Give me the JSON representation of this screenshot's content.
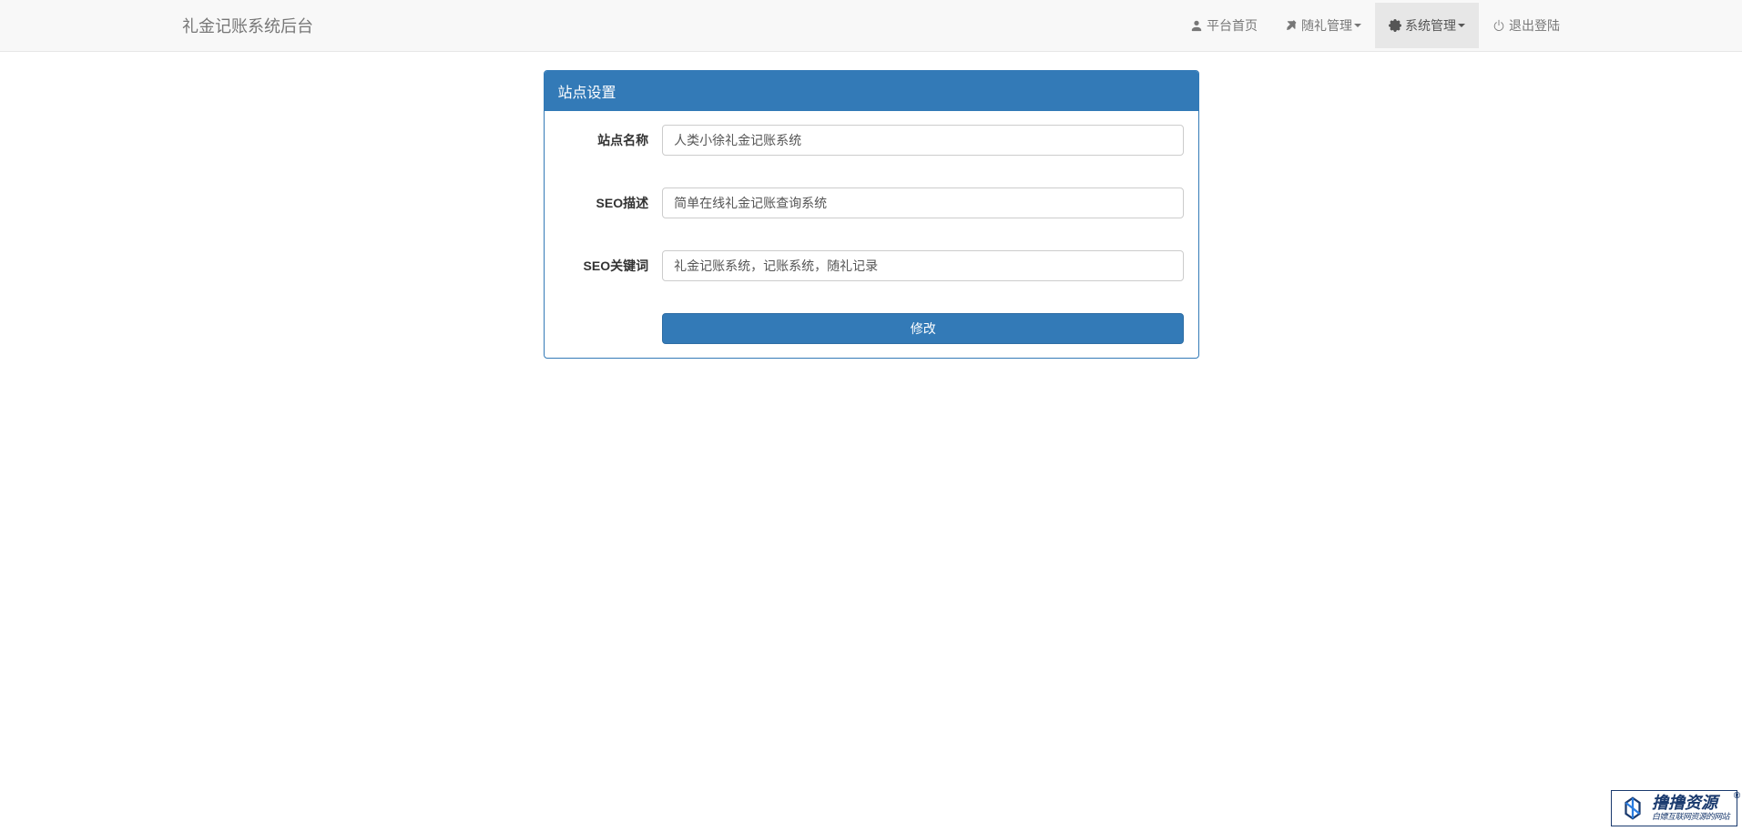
{
  "navbar": {
    "brand": "礼金记账系统后台",
    "items": [
      {
        "label": "平台首页",
        "icon": "user"
      },
      {
        "label": "随礼管理",
        "icon": "pushpin",
        "dropdown": true
      },
      {
        "label": "系统管理",
        "icon": "gear",
        "dropdown": true,
        "active": true
      },
      {
        "label": "退出登陆",
        "icon": "power"
      }
    ]
  },
  "panel": {
    "title": "站点设置",
    "fields": [
      {
        "label": "站点名称",
        "value": "人类小徐礼金记账系统"
      },
      {
        "label": "SEO描述",
        "value": "简单在线礼金记账查询系统"
      },
      {
        "label": "SEO关键词",
        "value": "礼金记账系统，记账系统，随礼记录"
      }
    ],
    "submit_label": "修改"
  },
  "watermark": {
    "main": "撸撸资源",
    "trademark": "®",
    "sub": "白嫖互联网资源的网站"
  }
}
